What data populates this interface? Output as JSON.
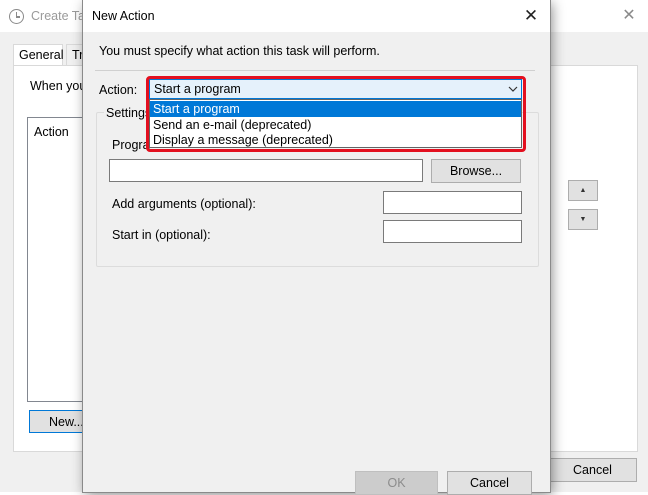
{
  "background_window": {
    "title": "Create Tas",
    "close_glyph": "✕",
    "tabs": [
      "General",
      "Tr"
    ],
    "when_text": "When you",
    "action_column_header": "Action",
    "new_button": "New...",
    "up_glyph": "▲",
    "down_glyph": "▼",
    "cancel_button": "Cancel"
  },
  "dialog": {
    "title": "New Action",
    "close_glyph": "✕",
    "instruction": "You must specify what action this task will perform.",
    "action_label": "Action:",
    "action_selected": "Start a program",
    "dropdown_arrow_glyph": "⌄",
    "action_options": [
      "Start a program",
      "Send an e-mail (deprecated)",
      "Display a message (deprecated)"
    ],
    "settings_label": "Settings",
    "program_label": "Progra",
    "program_value": "",
    "browse_button": "Browse...",
    "arguments_label": "Add arguments (optional):",
    "arguments_value": "",
    "start_in_label": "Start in (optional):",
    "start_in_value": "",
    "ok_button": "OK",
    "cancel_button": "Cancel"
  },
  "colors": {
    "highlight": "#e3101f",
    "selection": "#0078d7"
  },
  "icons": [
    "clock-icon",
    "close-icon",
    "chevron-down-icon",
    "arrow-up-icon",
    "arrow-down-icon"
  ]
}
